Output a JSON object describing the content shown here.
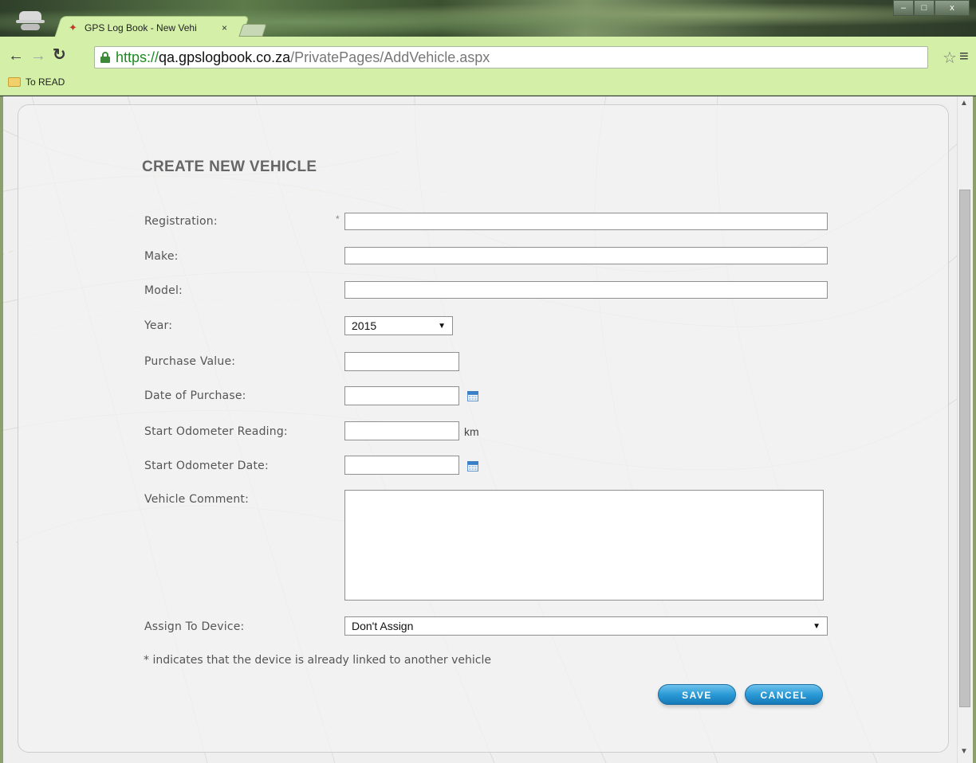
{
  "browser": {
    "tab_title": "GPS Log Book - New Vehi",
    "tab_close": "×",
    "url_scheme": "https://",
    "url_host": "qa.gpslogbook.co.za",
    "url_path": "/PrivatePages/AddVehicle.aspx",
    "bookmark": "To READ",
    "window_min": "–",
    "window_max": "□",
    "window_close": "x"
  },
  "form": {
    "heading": "CREATE NEW VEHICLE",
    "required_marker": "*",
    "registration_label": "Registration:",
    "make_label": "Make:",
    "model_label": "Model:",
    "year_label": "Year:",
    "year_value": "2015",
    "purchase_value_label": "Purchase Value:",
    "date_of_purchase_label": "Date of Purchase:",
    "start_odometer_reading_label": "Start Odometer Reading:",
    "odometer_unit": "km",
    "start_odometer_date_label": "Start Odometer Date:",
    "vehicle_comment_label": "Vehicle Comment:",
    "assign_device_label": "Assign To Device:",
    "assign_device_value": "Don't Assign",
    "note": "* indicates that the device is already linked to another vehicle",
    "save_label": "SAVE",
    "cancel_label": "CANCEL"
  },
  "icons": {
    "incognito": "incognito-icon",
    "back": "arrow-left-icon",
    "forward": "arrow-right-icon",
    "reload": "reload-icon",
    "lock": "lock-icon",
    "star": "star-icon",
    "menu": "hamburger-menu-icon",
    "folder": "folder-icon",
    "calendar": "calendar-icon"
  },
  "colors": {
    "browser_chrome": "#d4f0a8",
    "button_blue": "#2a9ad6",
    "url_green": "#1e8a22"
  }
}
